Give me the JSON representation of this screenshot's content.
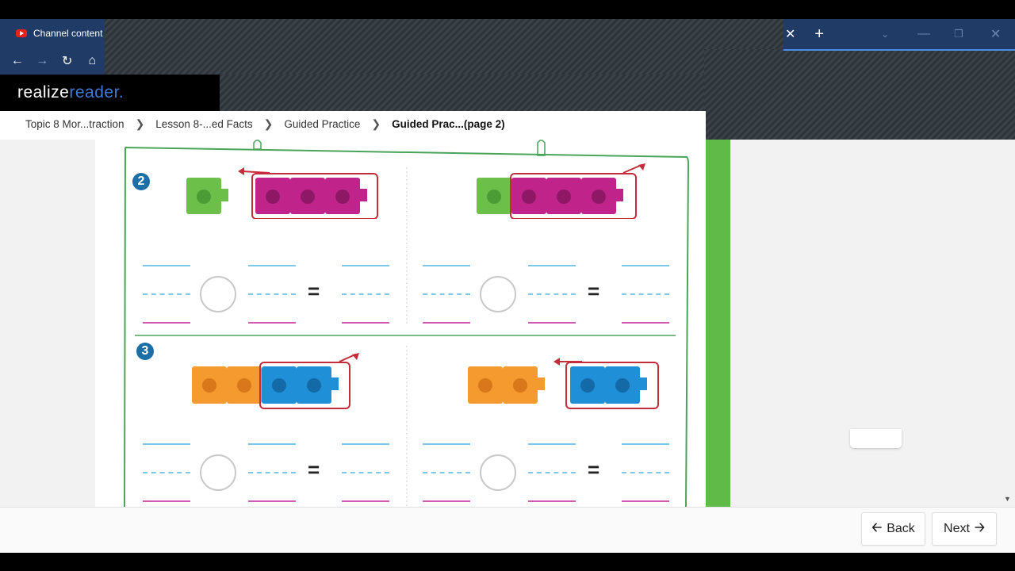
{
  "browser": {
    "tab_title": "Channel content",
    "window_controls": [
      "×",
      "+"
    ]
  },
  "brand": {
    "part1": "realize",
    "part2": "reader."
  },
  "breadcrumb": {
    "items": [
      "Topic 8 Mor...traction",
      "Lesson 8-...ed Facts",
      "Guided Practice",
      "Guided Prac...(page 2)"
    ]
  },
  "worksheet": {
    "problems": [
      {
        "number": "2",
        "left": {
          "green_cubes": 1,
          "magenta_cubes": 3,
          "arrow": "left"
        },
        "right": {
          "green_cubes": 1,
          "magenta_cubes": 3,
          "arrow": "right"
        }
      },
      {
        "number": "3",
        "left": {
          "orange_cubes": 2,
          "blue_cubes": 2,
          "arrow": "right"
        },
        "right": {
          "orange_cubes": 2,
          "blue_cubes": 2,
          "arrow": "left"
        }
      }
    ],
    "equals": "="
  },
  "footer": {
    "back": "Back",
    "next": "Next"
  },
  "colors": {
    "chrome": "#1f3b66",
    "green": "#5fba47",
    "accent_blue": "#3d7ad6"
  }
}
